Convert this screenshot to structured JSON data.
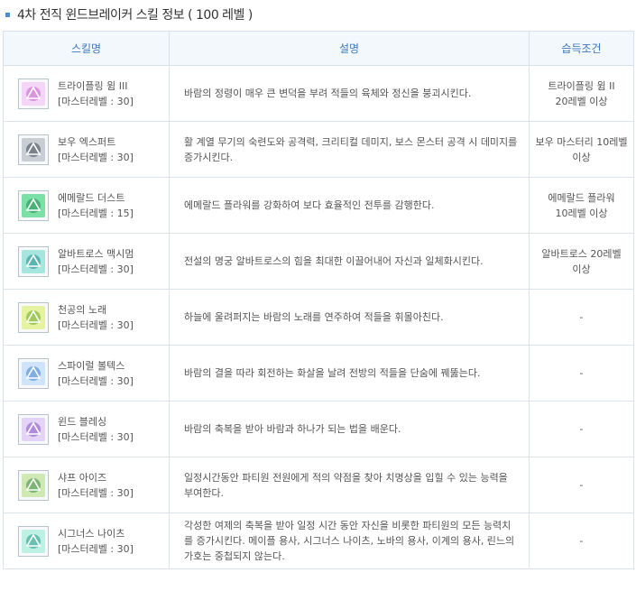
{
  "page_title": "4차 전직 윈드브레이커 스킬 정보 ( 100 레벨 )",
  "table": {
    "headers": {
      "name": "스킬명",
      "desc": "설명",
      "req": "습득조건"
    },
    "rows": [
      {
        "icon": "tripling-wim-icon",
        "colors": [
          "#c85fc9",
          "#f4d5f7"
        ],
        "name": "트라이플링 윔 III",
        "master": "[마스터레벨 : 30]",
        "desc": "바람의 정령이 매우 큰 변덕을 부려 적들의 육체와 정신을 붕괴시킨다.",
        "req1": "트라이플링 윔 II",
        "req2": "20레벨 이상"
      },
      {
        "icon": "bow-expert-icon",
        "colors": [
          "#3a4550",
          "#c8ced4"
        ],
        "name": "보우 엑스퍼트",
        "master": "[마스터레벨 : 30]",
        "desc": "활 계열 무기의 숙련도와 공격력, 크리티컬 데미지, 보스 몬스터 공격 시 데미지를 증가시킨다.",
        "req1": "보우 마스터리 10레벨",
        "req2": "이상"
      },
      {
        "icon": "emerald-dust-icon",
        "colors": [
          "#1d8a4e",
          "#7be0a6"
        ],
        "name": "에메랄드 더스트",
        "master": "[마스터레벨 : 15]",
        "desc": "에메랄드 플라워를 강화하여 보다 효율적인 전투를 감행한다.",
        "req1": "에메랄드 플라워",
        "req2": "10레벨 이상"
      },
      {
        "icon": "albatross-max-icon",
        "colors": [
          "#1e8c8c",
          "#a6e6df"
        ],
        "name": "알바트로스 맥시멈",
        "master": "[마스터레벨 : 30]",
        "desc": "전설의 명궁 알바트로스의 힘을 최대한 이끌어내어 자신과 일체화시킨다.",
        "req1": "알바트로스 20레벨",
        "req2": "이상"
      },
      {
        "icon": "song-of-heaven-icon",
        "colors": [
          "#6aa823",
          "#e5f2a0"
        ],
        "name": "천공의 노래",
        "master": "[마스터레벨 : 30]",
        "desc": "하늘에 울려퍼지는 바람의 노래를 연주하여 적들을 휘몰아친다.",
        "req1": "-",
        "req2": ""
      },
      {
        "icon": "spiral-vortex-icon",
        "colors": [
          "#3f7fd1",
          "#cfe4fb"
        ],
        "name": "스파이럴 볼텍스",
        "master": "[마스터레벨 : 30]",
        "desc": "바람의 결을 따라 회전하는 화살을 날려 전방의 적들을 단숨에 꿰뚫는다.",
        "req1": "-",
        "req2": ""
      },
      {
        "icon": "wind-blessing-icon",
        "colors": [
          "#8a4fc4",
          "#e3d3f6"
        ],
        "name": "윈드 블레싱",
        "master": "[마스터레벨 : 30]",
        "desc": "바람의 축복을 받아 바람과 하나가 되는 법을 배운다.",
        "req1": "-",
        "req2": ""
      },
      {
        "icon": "sharp-eyes-icon",
        "colors": [
          "#3b8a3e",
          "#cfe9b4"
        ],
        "name": "샤프 아이즈",
        "master": "[마스터레벨 : 30]",
        "desc": "일정시간동안 파티원 전원에게 적의 약점을 찾아 치명상을 입힐 수 있는 능력을 부여한다.",
        "req1": "-",
        "req2": ""
      },
      {
        "icon": "cygnus-knights-icon",
        "colors": [
          "#1f9a86",
          "#bff0e4"
        ],
        "name": "시그너스 나이츠",
        "master": "[마스터레벨 : 30]",
        "desc": "각성한 여제의 축복을 받아 일정 시간 동안 자신을 비롯한 파티원의 모든 능력치를 증가시킨다. 메이플 용사, 시그너스 나이츠, 노바의 용사, 이계의 용사, 린느의 가호는 중첩되지 않는다.",
        "req1": "-",
        "req2": ""
      }
    ]
  }
}
